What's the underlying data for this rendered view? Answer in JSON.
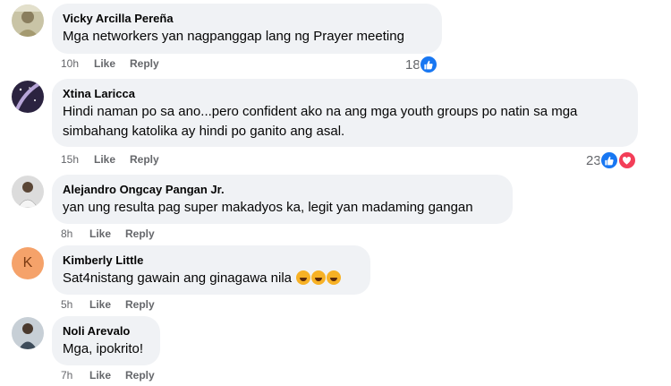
{
  "comments": [
    {
      "author": "Vicky Arcilla Pereña",
      "text": "Mga networkers yan nagpanggap lang ng Prayer meeting",
      "time": "10h",
      "like": "Like",
      "reply": "Reply",
      "reaction_count": "18"
    },
    {
      "author": "Xtina Laricca",
      "text_line1": "Hindi naman po sa ano...pero confident ako na ang mga youth groups po natin sa mga",
      "text_line2": "simbahang katolika ay hindi po ganito ang asal.",
      "time": "15h",
      "like": "Like",
      "reply": "Reply",
      "reaction_count": "23"
    },
    {
      "author": "Alejandro Ongcay Pangan Jr.",
      "text": "yan ung resulta pag super makadyos ka, legit yan madaming gangan",
      "time": "8h",
      "like": "Like",
      "reply": "Reply"
    },
    {
      "author": "Kimberly Little",
      "avatar_letter": "K",
      "text": "Sat4nistang gawain ang ginagawa nila",
      "time": "5h",
      "like": "Like",
      "reply": "Reply"
    },
    {
      "author": "Noli Arevalo",
      "text": "Mga, ipokrito!",
      "time": "7h",
      "like": "Like",
      "reply": "Reply"
    }
  ],
  "colors": {
    "bubble": "#f0f2f5",
    "muted": "#65676b",
    "like_blue": "#1877f2",
    "love_red": "#f33e58",
    "avatar_k": "#f5a26a"
  },
  "icons": [
    "like-reaction-icon",
    "love-reaction-icon",
    "rofl-emoji-icon"
  ]
}
